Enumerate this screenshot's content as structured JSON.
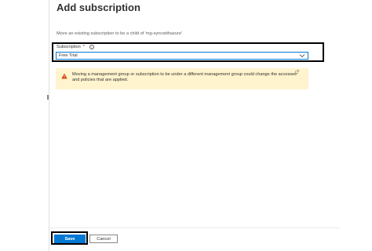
{
  "header": {
    "title": "Add subscription"
  },
  "main": {
    "description": "Move an existing subscription to be a child of 'mg-syncwithazure'",
    "subscription": {
      "label": "Subscription",
      "required_marker": "*",
      "selected_value": "Free Trial"
    },
    "warning": {
      "text": "Moving a management group or subscription to be under a different management group could change the accesses and policies that are applied.",
      "icon": "warning-icon"
    }
  },
  "footer": {
    "save_label": "Save",
    "cancel_label": "Cancel"
  },
  "colors": {
    "accent": "#0078d4",
    "warning_bg": "#fff4ce",
    "warning_icon": "#d83b01"
  }
}
